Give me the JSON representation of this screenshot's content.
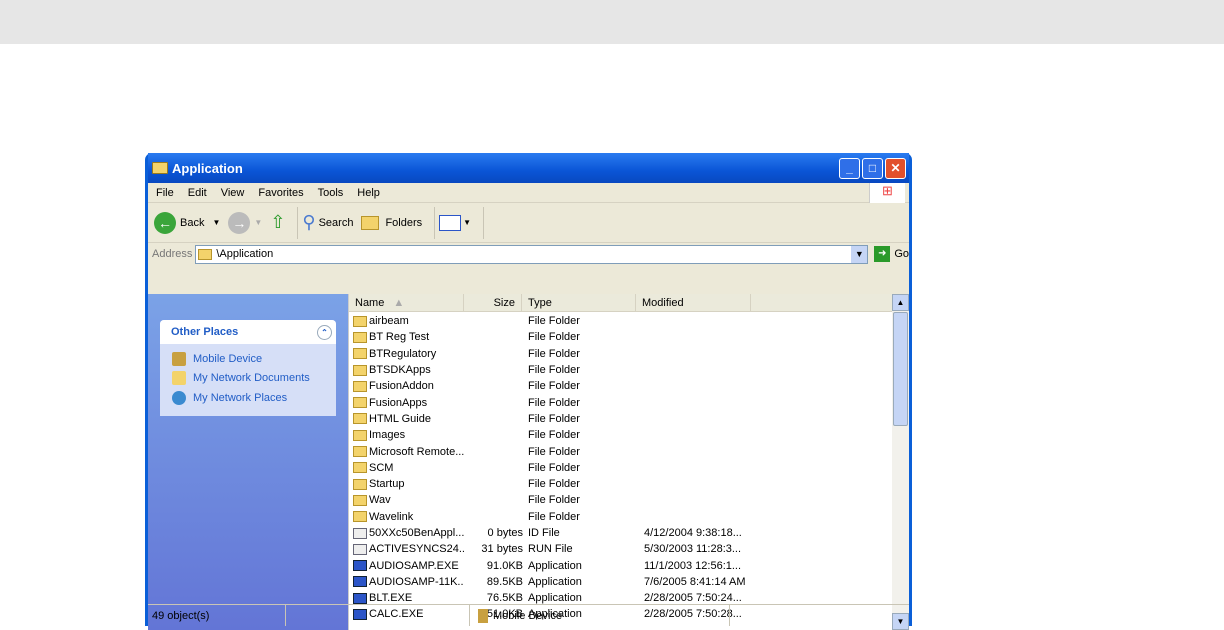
{
  "window": {
    "title": "Application"
  },
  "menu": [
    "File",
    "Edit",
    "View",
    "Favorites",
    "Tools",
    "Help"
  ],
  "toolbar": {
    "back": "Back",
    "search": "Search",
    "folders": "Folders"
  },
  "address": {
    "label": "Address",
    "value": "\\Application",
    "go": "Go"
  },
  "left": {
    "section": "Other Places",
    "places": [
      "Mobile Device",
      "My Network Documents",
      "My Network Places"
    ]
  },
  "columns": [
    "Name",
    "Size",
    "Type",
    "Modified"
  ],
  "files": [
    {
      "name": "airbeam",
      "size": "",
      "type": "File Folder",
      "modified": "",
      "icon": "folder"
    },
    {
      "name": "BT Reg Test",
      "size": "",
      "type": "File Folder",
      "modified": "",
      "icon": "folder"
    },
    {
      "name": "BTRegulatory",
      "size": "",
      "type": "File Folder",
      "modified": "",
      "icon": "folder"
    },
    {
      "name": "BTSDKApps",
      "size": "",
      "type": "File Folder",
      "modified": "",
      "icon": "folder"
    },
    {
      "name": "FusionAddon",
      "size": "",
      "type": "File Folder",
      "modified": "",
      "icon": "folder"
    },
    {
      "name": "FusionApps",
      "size": "",
      "type": "File Folder",
      "modified": "",
      "icon": "folder"
    },
    {
      "name": "HTML Guide",
      "size": "",
      "type": "File Folder",
      "modified": "",
      "icon": "folder"
    },
    {
      "name": "Images",
      "size": "",
      "type": "File Folder",
      "modified": "",
      "icon": "folder"
    },
    {
      "name": "Microsoft Remote...",
      "size": "",
      "type": "File Folder",
      "modified": "",
      "icon": "folder"
    },
    {
      "name": "SCM",
      "size": "",
      "type": "File Folder",
      "modified": "",
      "icon": "folder"
    },
    {
      "name": "Startup",
      "size": "",
      "type": "File Folder",
      "modified": "",
      "icon": "folder"
    },
    {
      "name": "Wav",
      "size": "",
      "type": "File Folder",
      "modified": "",
      "icon": "folder"
    },
    {
      "name": "Wavelink",
      "size": "",
      "type": "File Folder",
      "modified": "",
      "icon": "folder"
    },
    {
      "name": "50XXc50BenAppl....",
      "size": "0 bytes",
      "type": "ID File",
      "modified": "4/12/2004  9:38:18...",
      "icon": "doc"
    },
    {
      "name": "ACTIVESYNCS24....",
      "size": "31 bytes",
      "type": "RUN File",
      "modified": "5/30/2003  11:28:3...",
      "icon": "doc"
    },
    {
      "name": "AUDIOSAMP.EXE",
      "size": "91.0KB",
      "type": "Application",
      "modified": "11/1/2003  12:56:1...",
      "icon": "app"
    },
    {
      "name": "AUDIOSAMP-11K...",
      "size": "89.5KB",
      "type": "Application",
      "modified": "7/6/2005  8:41:14 AM",
      "icon": "app"
    },
    {
      "name": "BLT.EXE",
      "size": "76.5KB",
      "type": "Application",
      "modified": "2/28/2005  7:50:24...",
      "icon": "app"
    },
    {
      "name": "CALC.EXE",
      "size": "51.0KB",
      "type": "Application",
      "modified": "2/28/2005  7:50:28...",
      "icon": "app"
    }
  ],
  "status": {
    "count": "49 object(s)",
    "location": "Mobile Device"
  }
}
